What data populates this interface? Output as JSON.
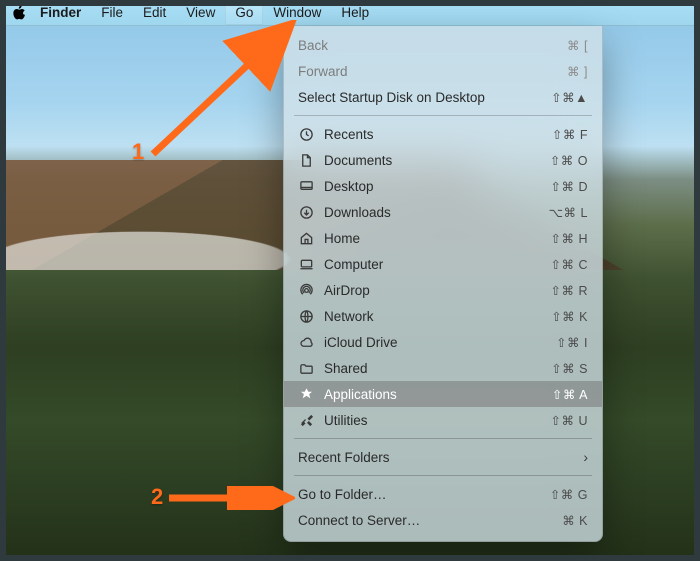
{
  "menubar": {
    "app": "Finder",
    "items": [
      "File",
      "Edit",
      "View",
      "Go",
      "Window",
      "Help"
    ],
    "active": "Go"
  },
  "go_menu": {
    "back": {
      "label": "Back",
      "shortcut": "⌘ ["
    },
    "forward": {
      "label": "Forward",
      "shortcut": "⌘ ]"
    },
    "select_startup": {
      "label": "Select Startup Disk on Desktop",
      "shortcut": "⇧⌘▲"
    },
    "places": [
      {
        "icon": "clock-icon",
        "label": "Recents",
        "shortcut": "⇧⌘ F"
      },
      {
        "icon": "document-icon",
        "label": "Documents",
        "shortcut": "⇧⌘ O"
      },
      {
        "icon": "desktop-icon",
        "label": "Desktop",
        "shortcut": "⇧⌘ D"
      },
      {
        "icon": "download-icon",
        "label": "Downloads",
        "shortcut": "⌥⌘ L"
      },
      {
        "icon": "home-icon",
        "label": "Home",
        "shortcut": "⇧⌘ H"
      },
      {
        "icon": "computer-icon",
        "label": "Computer",
        "shortcut": "⇧⌘ C"
      },
      {
        "icon": "airdrop-icon",
        "label": "AirDrop",
        "shortcut": "⇧⌘ R"
      },
      {
        "icon": "network-icon",
        "label": "Network",
        "shortcut": "⇧⌘ K"
      },
      {
        "icon": "cloud-icon",
        "label": "iCloud Drive",
        "shortcut": "⇧⌘ I"
      },
      {
        "icon": "shared-icon",
        "label": "Shared",
        "shortcut": "⇧⌘ S"
      },
      {
        "icon": "apps-icon",
        "label": "Applications",
        "shortcut": "⇧⌘ A",
        "selected": true
      },
      {
        "icon": "utilities-icon",
        "label": "Utilities",
        "shortcut": "⇧⌘ U"
      }
    ],
    "recent_folders": {
      "label": "Recent Folders"
    },
    "goto_folder": {
      "label": "Go to Folder…",
      "shortcut": "⇧⌘ G"
    },
    "connect_server": {
      "label": "Connect to Server…",
      "shortcut": "⌘ K"
    }
  },
  "annotations": {
    "one": "1",
    "two": "2"
  }
}
